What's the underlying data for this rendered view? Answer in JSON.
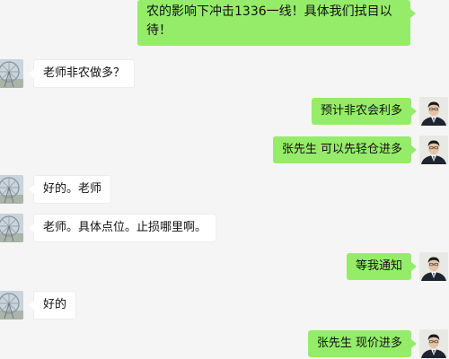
{
  "conversation": {
    "messages": [
      {
        "side": "out",
        "text": "农的影响下冲击1336一线！具体我们拭目以待！"
      },
      {
        "side": "in",
        "text": "老师非农做多？"
      },
      {
        "side": "out",
        "text": "预计非农会利多"
      },
      {
        "side": "out",
        "text": "张先生  可以先轻仓进多"
      },
      {
        "side": "in",
        "text": "好的。老师"
      },
      {
        "side": "in",
        "text": "老师。具体点位。止损哪里啊。"
      },
      {
        "side": "out",
        "text": "等我通知"
      },
      {
        "side": "in",
        "text": "好的"
      },
      {
        "side": "out",
        "text": "张先生   现价进多"
      }
    ]
  },
  "colors": {
    "background": "#f5f5f5",
    "outgoing_bubble": "#95ec69",
    "incoming_bubble": "#ffffff"
  },
  "icons": {
    "incoming_avatar": "ferris-wheel-avatar-icon",
    "outgoing_avatar": "man-in-suit-avatar-icon"
  }
}
